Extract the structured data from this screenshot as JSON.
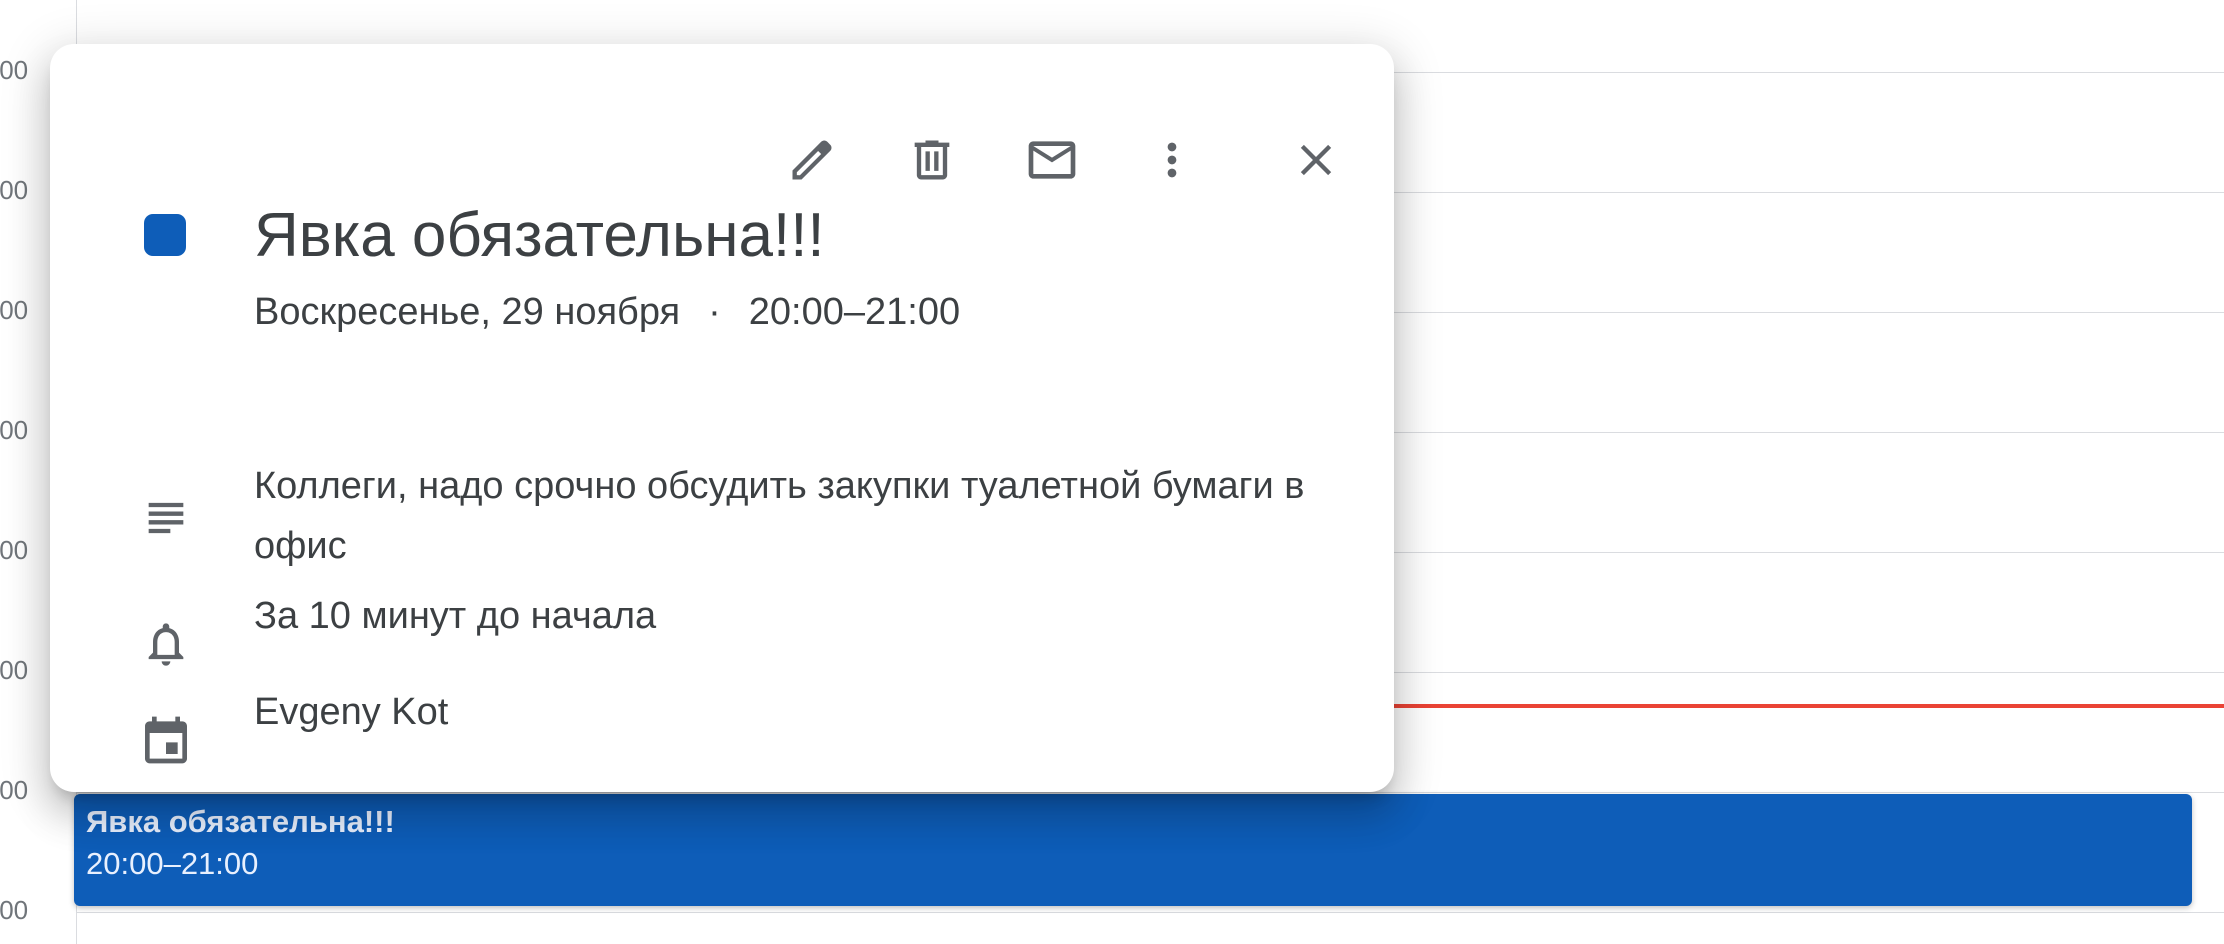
{
  "calendar": {
    "time_labels": [
      ":00",
      ":00",
      ":00",
      ":00",
      ":00",
      ":00",
      ":00",
      ":00"
    ],
    "accent_color": "#0e5db8",
    "now_line_color": "#ea4335"
  },
  "popup": {
    "toolbar": {
      "edit_icon": "pencil-icon",
      "delete_icon": "trash-icon",
      "email_icon": "mail-icon",
      "more_icon": "more-vert-icon",
      "close_icon": "close-icon"
    },
    "title": "Явка обязательна!!!",
    "date": "Воскресенье, 29 ноября",
    "separator": "·",
    "time_range": "20:00–21:00",
    "description": "Коллеги, надо срочно обсудить закупки туалетной бумаги в офис",
    "reminder": "За 10 минут до начала",
    "calendar_owner": "Evgeny Kot"
  },
  "event_chip": {
    "title": "Явка обязательна!!!",
    "time": "20:00–21:00"
  }
}
